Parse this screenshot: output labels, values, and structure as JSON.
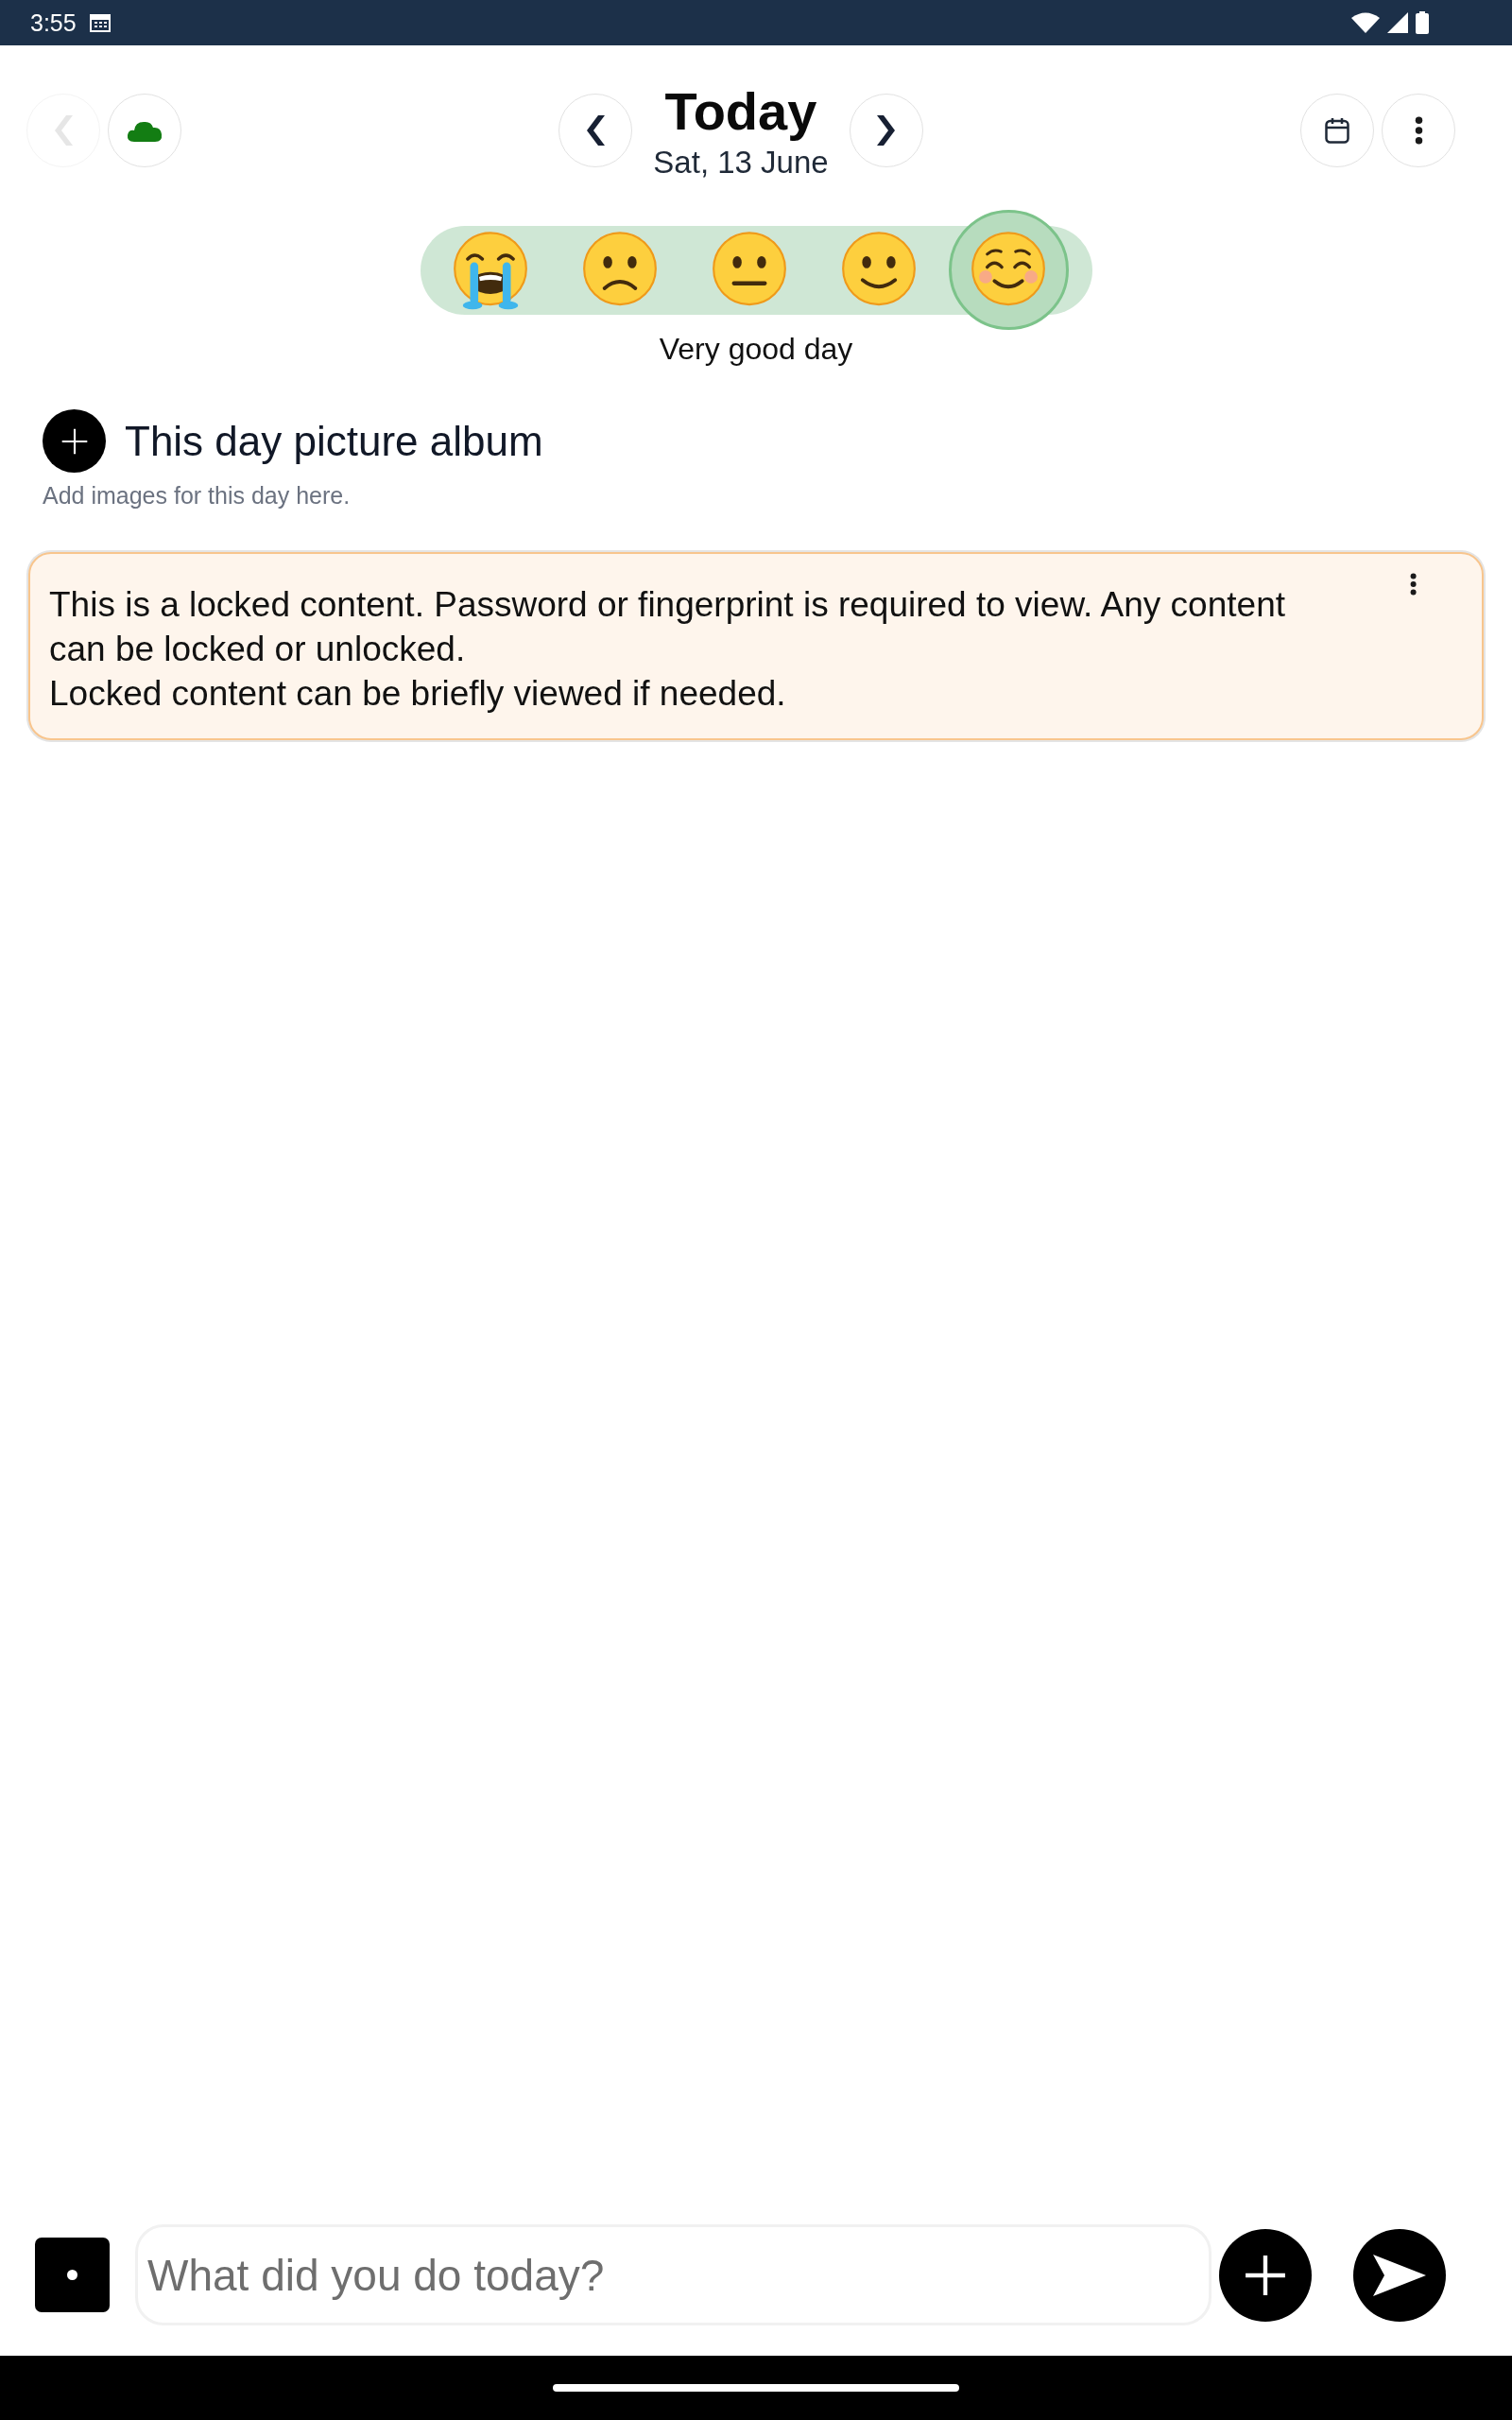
{
  "status_bar": {
    "time": "3:55"
  },
  "header": {
    "back": {
      "disabled": true
    },
    "title": "Today",
    "date": "Sat, 13 June"
  },
  "mood": {
    "options": [
      {
        "kind": "crying",
        "selected": false
      },
      {
        "kind": "sad",
        "selected": false
      },
      {
        "kind": "neutral",
        "selected": false
      },
      {
        "kind": "smile",
        "selected": false
      },
      {
        "kind": "blush",
        "selected": true
      }
    ],
    "label": "Very good day"
  },
  "album": {
    "title": "This day picture album",
    "hint": "Add images for this day here."
  },
  "entries": [
    {
      "paragraphs": [
        "This is a locked content. Password or fingerprint is required to view. Any content can be locked or unlocked.",
        "Locked content can be briefly viewed if needed."
      ]
    }
  ],
  "composer": {
    "placeholder": "What did you do today?"
  }
}
